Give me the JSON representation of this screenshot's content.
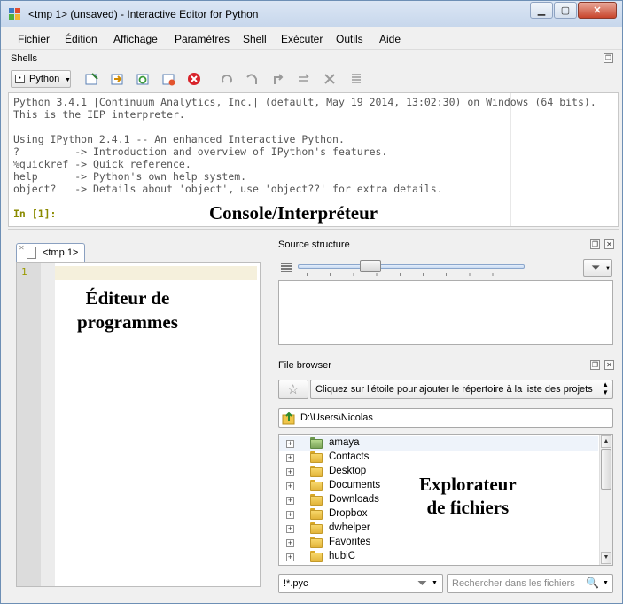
{
  "window": {
    "title": "<tmp 1> (unsaved) - Interactive Editor for Python",
    "minimize_icon": "minimize-icon",
    "maximize_icon": "maximize-icon",
    "close_icon": "close-icon"
  },
  "menu": [
    "Fichier",
    "Édition",
    "Affichage",
    "Paramètres",
    "Shell",
    "Exécuter",
    "Outils",
    "Aide"
  ],
  "shells": {
    "title": "Shells",
    "python_button": "Python",
    "toolbar_icons": [
      "new-shell-icon",
      "run-icon",
      "restart-icon",
      "interrupt-icon",
      "terminate-icon",
      "debug-icon",
      "step-over-icon",
      "step-out-icon",
      "step-into-icon",
      "stop-debug-icon",
      "stack-icon"
    ]
  },
  "console": {
    "lines": [
      "Python 3.4.1 |Continuum Analytics, Inc.| (default, May 19 2014, 13:02:30) on Windows (64 bits).",
      "This is the IEP interpreter.",
      "",
      "Using IPython 2.4.1 -- An enhanced Interactive Python.",
      "?         -> Introduction and overview of IPython's features.",
      "%quickref -> Quick reference.",
      "help      -> Python's own help system.",
      "object?   -> Details about 'object', use 'object??' for extra details."
    ],
    "prompt": "In [1]:",
    "overlay_label": "Console/Interpréteur"
  },
  "editor": {
    "tab_label": "<tmp 1>",
    "line_number": "1",
    "overlay_line1": "Éditeur de",
    "overlay_line2": "programmes"
  },
  "source_structure": {
    "title": "Source structure",
    "slider_level": 0.3
  },
  "file_browser": {
    "title": "File browser",
    "project_hint": "Cliquez sur l'étoile pour ajouter le répertoire à la liste des projets",
    "path": "D:\\Users\\Nicolas",
    "items": [
      "amaya",
      "Contacts",
      "Desktop",
      "Documents",
      "Downloads",
      "Dropbox",
      "dwhelper",
      "Favorites",
      "hubiC"
    ],
    "filter": "!*.pyc",
    "search_placeholder": "Rechercher dans les fichiers",
    "overlay_line1": "Explorateur",
    "overlay_line2": "de fichiers"
  }
}
